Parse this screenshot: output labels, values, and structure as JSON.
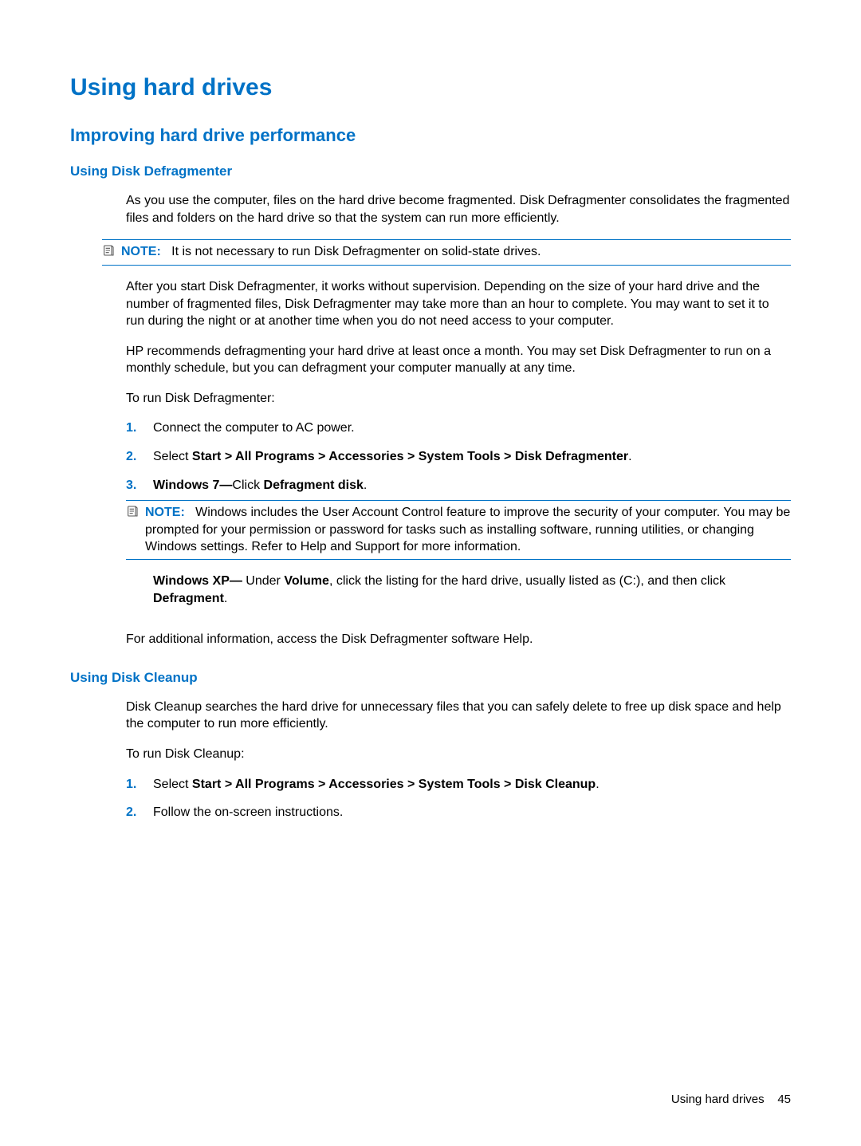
{
  "h1": "Using hard drives",
  "h2": "Improving hard drive performance",
  "defrag": {
    "h3": "Using Disk Defragmenter",
    "p1": "As you use the computer, files on the hard drive become fragmented. Disk Defragmenter consolidates the fragmented files and folders on the hard drive so that the system can run more efficiently.",
    "note1_label": "NOTE:",
    "note1_text": "It is not necessary to run Disk Defragmenter on solid-state drives.",
    "p2": "After you start Disk Defragmenter, it works without supervision. Depending on the size of your hard drive and the number of fragmented files, Disk Defragmenter may take more than an hour to complete. You may want to set it to run during the night or at another time when you do not need access to your computer.",
    "p3": "HP recommends defragmenting your hard drive at least once a month. You may set Disk Defragmenter to run on a monthly schedule, but you can defragment your computer manually at any time.",
    "p4": "To run Disk Defragmenter:",
    "steps": {
      "n1": "1.",
      "s1": "Connect the computer to AC power.",
      "n2": "2.",
      "s2_pre": "Select ",
      "s2_bold": "Start > All Programs > Accessories > System Tools > Disk Defragmenter",
      "s2_post": ".",
      "n3": "3.",
      "s3_b1": "Windows 7—",
      "s3_mid": "Click ",
      "s3_b2": "Defragment disk",
      "s3_post": ".",
      "note2_label": "NOTE:",
      "note2_text": "Windows includes the User Account Control feature to improve the security of your computer. You may be prompted for your permission or password for tasks such as installing software, running utilities, or changing Windows settings. Refer to Help and Support for more information.",
      "xp_b1": "Windows XP—",
      "xp_t1": " Under ",
      "xp_b2": "Volume",
      "xp_t2": ", click the listing for the hard drive, usually listed as (C:), and then click ",
      "xp_b3": "Defragment",
      "xp_t3": "."
    },
    "p5": "For additional information, access the Disk Defragmenter software Help."
  },
  "cleanup": {
    "h3": "Using Disk Cleanup",
    "p1": "Disk Cleanup searches the hard drive for unnecessary files that you can safely delete to free up disk space and help the computer to run more efficiently.",
    "p2": "To run Disk Cleanup:",
    "steps": {
      "n1": "1.",
      "s1_pre": "Select ",
      "s1_bold": "Start > All Programs > Accessories > System Tools > Disk Cleanup",
      "s1_post": ".",
      "n2": "2.",
      "s2": "Follow the on-screen instructions."
    }
  },
  "footer": {
    "text": "Using hard drives",
    "page": "45"
  }
}
